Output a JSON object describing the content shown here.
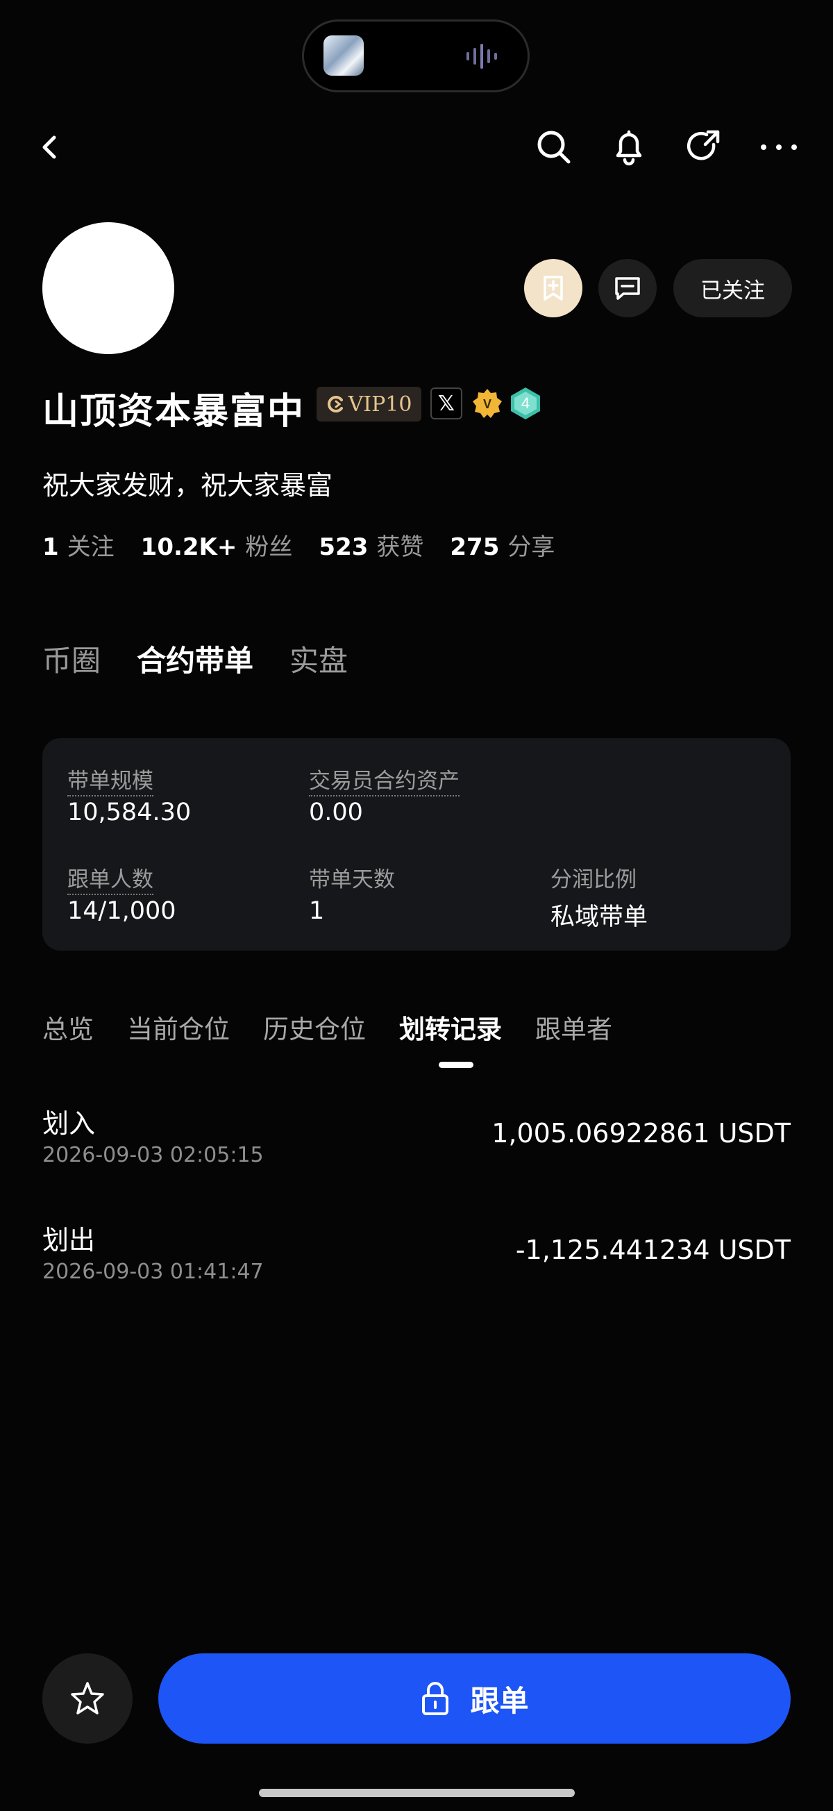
{
  "header": {
    "back_icon": "back-arrow-icon",
    "search_icon": "search-icon",
    "bell_icon": "bell-icon",
    "share_icon": "share-icon",
    "more_icon": "more-icon"
  },
  "profile": {
    "name": "山顶资本暴富中",
    "vip_label": "VIP10",
    "x_badge": "𝕏",
    "verified_badge": "V",
    "level_badge": "4",
    "bio": "祝大家发财，祝大家暴富",
    "follow_button": "已关注",
    "stats": [
      {
        "value": "1",
        "label": "关注"
      },
      {
        "value": "10.2K+",
        "label": "粉丝"
      },
      {
        "value": "523",
        "label": "获赞"
      },
      {
        "value": "275",
        "label": "分享"
      }
    ]
  },
  "main_tabs": [
    {
      "label": "币圈",
      "active": false
    },
    {
      "label": "合约带单",
      "active": true
    },
    {
      "label": "实盘",
      "active": false
    }
  ],
  "metrics": {
    "scale_label": "带单规模",
    "scale_value": "10,584.30",
    "assets_label": "交易员合约资产",
    "assets_value": "0.00",
    "followers_label": "跟单人数",
    "followers_value": "14/1,000",
    "days_label": "带单天数",
    "days_value": "1",
    "share_label": "分润比例",
    "share_value": "私域带单"
  },
  "sub_tabs": [
    {
      "label": "总览",
      "active": false
    },
    {
      "label": "当前仓位",
      "active": false
    },
    {
      "label": "历史仓位",
      "active": false
    },
    {
      "label": "划转记录",
      "active": true
    },
    {
      "label": "跟单者",
      "active": false
    }
  ],
  "records": [
    {
      "type": "划入",
      "time": "2026-09-03 02:05:15",
      "amount": "1,005.06922861 USDT"
    },
    {
      "type": "划出",
      "time": "2026-09-03 01:41:47",
      "amount": "-1,125.441234 USDT"
    }
  ],
  "bottom": {
    "copy_button": "跟单"
  },
  "colors": {
    "background": "#050505",
    "card": "#16171a",
    "primary_button": "#1d55f6",
    "vip_text": "#e7c48f",
    "verified_gold": "#f2b637",
    "level_teal": "#3dbfa9"
  }
}
